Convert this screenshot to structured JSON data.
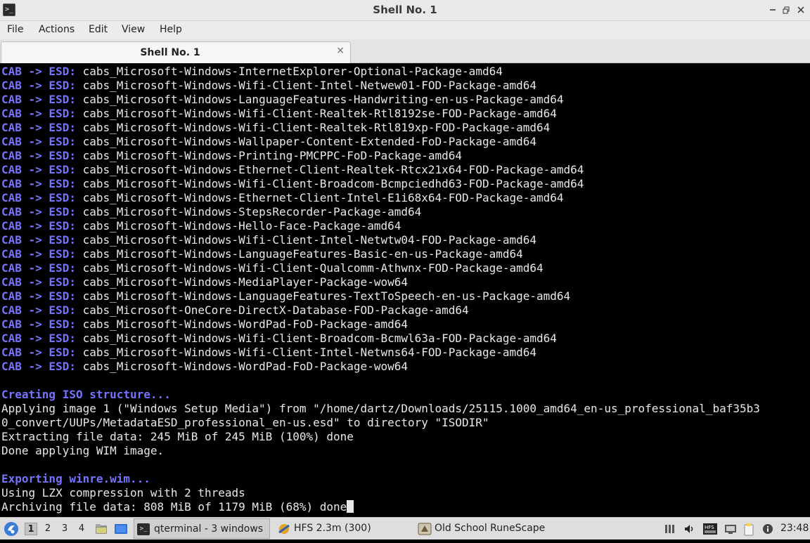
{
  "window": {
    "title": "Shell No. 1",
    "controls": {
      "minimize": "—",
      "restore": "⬚",
      "maximize": "⬚",
      "close": "✕"
    }
  },
  "menu": [
    "File",
    "Actions",
    "Edit",
    "View",
    "Help"
  ],
  "tab": {
    "label": "Shell No. 1",
    "close": "×"
  },
  "terminal": {
    "cab_lines": [
      "cabs_Microsoft-Windows-InternetExplorer-Optional-Package-amd64",
      "cabs_Microsoft-Windows-Wifi-Client-Intel-Netwew01-FOD-Package-amd64",
      "cabs_Microsoft-Windows-LanguageFeatures-Handwriting-en-us-Package-amd64",
      "cabs_Microsoft-Windows-Wifi-Client-Realtek-Rtl8192se-FOD-Package-amd64",
      "cabs_Microsoft-Windows-Wifi-Client-Realtek-Rtl819xp-FOD-Package-amd64",
      "cabs_Microsoft-Windows-Wallpaper-Content-Extended-FoD-Package-amd64",
      "cabs_Microsoft-Windows-Printing-PMCPPC-FoD-Package-amd64",
      "cabs_Microsoft-Windows-Ethernet-Client-Realtek-Rtcx21x64-FOD-Package-amd64",
      "cabs_Microsoft-Windows-Wifi-Client-Broadcom-Bcmpciedhd63-FOD-Package-amd64",
      "cabs_Microsoft-Windows-Ethernet-Client-Intel-E1i68x64-FOD-Package-amd64",
      "cabs_Microsoft-Windows-StepsRecorder-Package-amd64",
      "cabs_Microsoft-Windows-Hello-Face-Package-amd64",
      "cabs_Microsoft-Windows-Wifi-Client-Intel-Netwtw04-FOD-Package-amd64",
      "cabs_Microsoft-Windows-LanguageFeatures-Basic-en-us-Package-amd64",
      "cabs_Microsoft-Windows-Wifi-Client-Qualcomm-Athwnx-FOD-Package-amd64",
      "cabs_Microsoft-Windows-MediaPlayer-Package-wow64",
      "cabs_Microsoft-Windows-LanguageFeatures-TextToSpeech-en-us-Package-amd64",
      "cabs_Microsoft-OneCore-DirectX-Database-FOD-Package-amd64",
      "cabs_Microsoft-Windows-WordPad-FoD-Package-amd64",
      "cabs_Microsoft-Windows-Wifi-Client-Broadcom-Bcmwl63a-FOD-Package-amd64",
      "cabs_Microsoft-Windows-Wifi-Client-Intel-Netwns64-FOD-Package-amd64",
      "cabs_Microsoft-Windows-WordPad-FoD-Package-wow64"
    ],
    "cab_prefix": "CAB -> ESD:",
    "section_iso": "Creating ISO structure...",
    "apply_line_1": "Applying image 1 (\"Windows Setup Media\") from \"/home/dartz/Downloads/25115.1000_amd64_en-us_professional_baf35b3",
    "apply_line_2": "0_convert/UUPs/MetadataESD_professional_en-us.esd\" to directory \"ISODIR\"",
    "extract_line": "Extracting file data: 245 MiB of 245 MiB (100%) done",
    "done_line": "Done applying WIM image.",
    "section_winre": "Exporting winre.wim...",
    "lzx_line": "Using LZX compression with 2 threads",
    "archive_line": "Archiving file data: 808 MiB of 1179 MiB (68%) done"
  },
  "taskbar": {
    "workspaces": [
      "1",
      "2",
      "3",
      "4"
    ],
    "active_workspace": "1",
    "tasks": [
      {
        "label": "qterminal - 3 windows",
        "icon": "terminal-icon"
      },
      {
        "label": "HFS 2.3m (300)",
        "icon": "hfs-icon"
      },
      {
        "label": "Old School RuneScape",
        "icon": "runescape-icon"
      }
    ],
    "tray_hfs_label": "HFS",
    "clock": "23:48"
  },
  "colors": {
    "title_bar": "#e9e9e9",
    "terminal_bg": "#000000",
    "terminal_fg": "#e8e8e8",
    "terminal_highlight": "#7574ff",
    "taskbar": "#dedede"
  }
}
